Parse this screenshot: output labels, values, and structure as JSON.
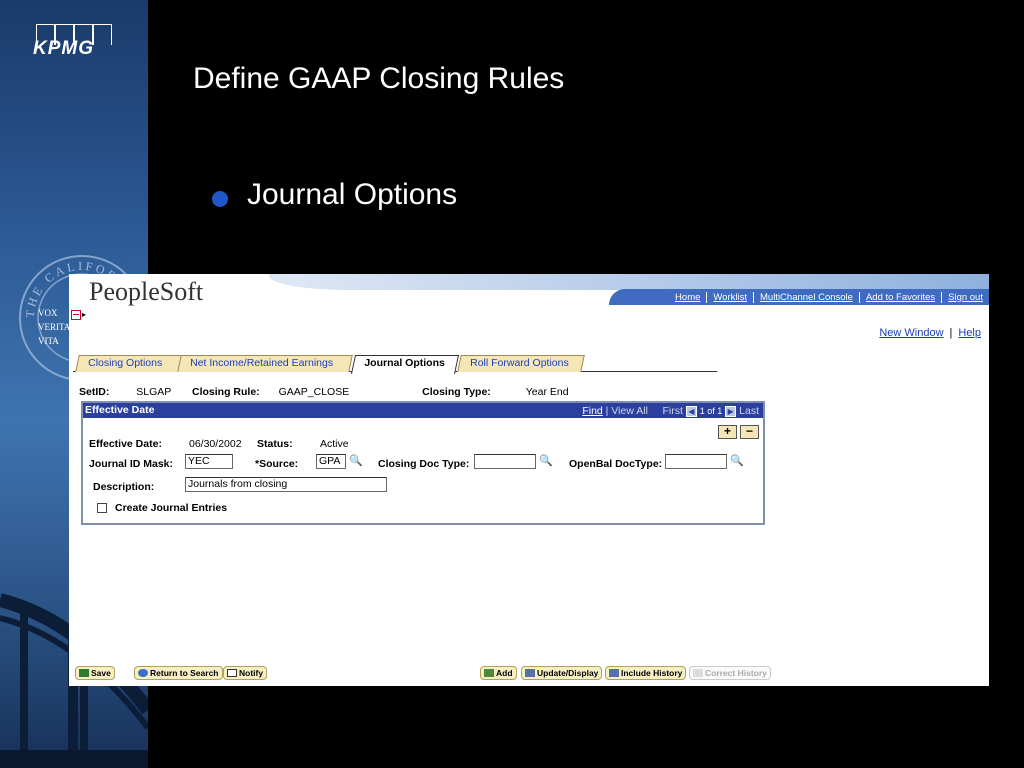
{
  "slide": {
    "brand": "KPMG",
    "title": "Define GAAP Closing Rules",
    "bullet": "Journal Options",
    "seal_text": "THE CALIFORNIA STATE",
    "seal_words": [
      "VOX",
      "VERITA",
      "VITA"
    ],
    "colors": {
      "sidebar": "#2c5a94",
      "background": "#000000",
      "bullet": "#1f56c8"
    }
  },
  "app": {
    "logo": "PeopleSoft",
    "nav_links": [
      "Home",
      "Worklist",
      "MultiChannel Console",
      "Add to Favorites",
      "Sign out"
    ],
    "top_links": {
      "new_window": "New Window",
      "help": "Help"
    },
    "tabs": [
      {
        "label": "Closing Options",
        "active": false
      },
      {
        "label": "Net Income/Retained Earnings",
        "active": false
      },
      {
        "label": "Journal Options",
        "active": true
      },
      {
        "label": "Roll Forward Options",
        "active": false
      }
    ],
    "header": {
      "setid_label": "SetID:",
      "setid_value": "SLGAP",
      "rule_label": "Closing Rule:",
      "rule_value": "GAAP_CLOSE",
      "type_label": "Closing Type:",
      "type_value": "Year End"
    },
    "grid": {
      "title": "Effective Date",
      "find": "Find",
      "view_all": "View All",
      "first": "First",
      "page_info": "1 of 1",
      "last": "Last",
      "add": "+",
      "remove": "−"
    },
    "form": {
      "eff_date_label": "Effective Date:",
      "eff_date_value": "06/30/2002",
      "status_label": "Status:",
      "status_value": "Active",
      "journal_mask_label": "Journal ID Mask:",
      "journal_mask_value": "YEC",
      "source_label": "*Source:",
      "source_value": "GPA",
      "closing_doc_label": "Closing Doc Type:",
      "closing_doc_value": "",
      "openbal_label": "OpenBal DocType:",
      "openbal_value": "",
      "description_label": "Description:",
      "description_value": "Journals from closing",
      "create_journal_label": "Create Journal Entries",
      "create_journal_checked": false
    },
    "buttons": {
      "save": "Save",
      "return_search": "Return to Search",
      "notify": "Notify",
      "add": "Add",
      "update_display": "Update/Display",
      "include_history": "Include History",
      "correct_history": "Correct History"
    }
  }
}
